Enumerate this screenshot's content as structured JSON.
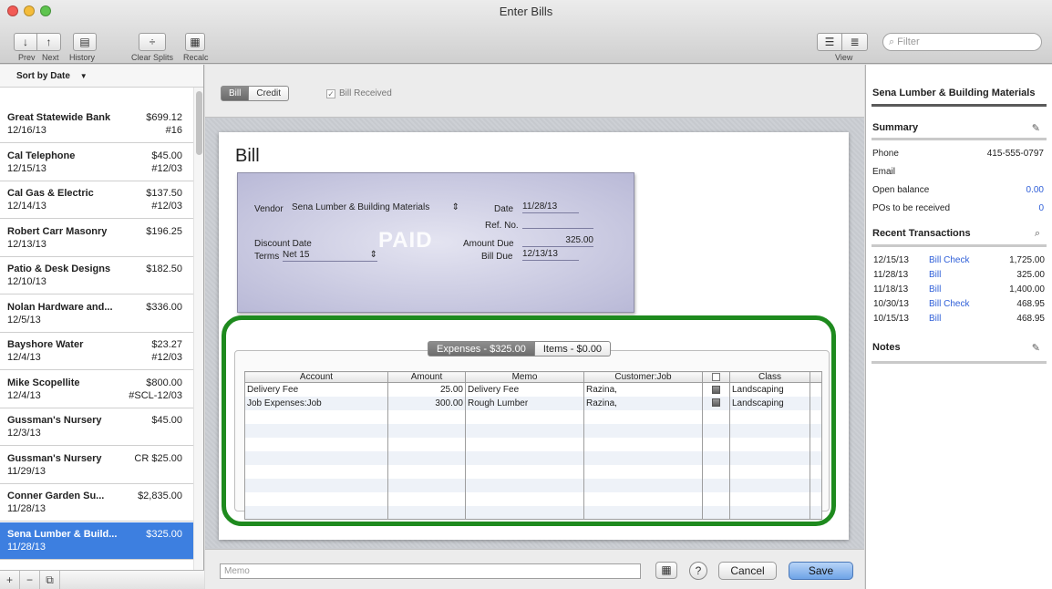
{
  "window": {
    "title": "Enter Bills"
  },
  "toolbar": {
    "prev": "Prev",
    "next": "Next",
    "history": "History",
    "clear_splits": "Clear Splits",
    "recalc": "Recalc",
    "view": "View",
    "filter_placeholder": "Filter"
  },
  "left": {
    "sort_label": "Sort by Date",
    "items": [
      {
        "name": "Great Statewide Bank",
        "date": "12/16/13",
        "amount": "$699.12",
        "ref": "#16"
      },
      {
        "name": "Cal Telephone",
        "date": "12/15/13",
        "amount": "$45.00",
        "ref": "#12/03"
      },
      {
        "name": "Cal Gas & Electric",
        "date": "12/14/13",
        "amount": "$137.50",
        "ref": "#12/03"
      },
      {
        "name": "Robert Carr Masonry",
        "date": "12/13/13",
        "amount": "$196.25",
        "ref": ""
      },
      {
        "name": "Patio & Desk Designs",
        "date": "12/10/13",
        "amount": "$182.50",
        "ref": ""
      },
      {
        "name": "Nolan Hardware and...",
        "date": "12/5/13",
        "amount": "$336.00",
        "ref": ""
      },
      {
        "name": "Bayshore Water",
        "date": "12/4/13",
        "amount": "$23.27",
        "ref": "#12/03"
      },
      {
        "name": "Mike Scopellite",
        "date": "12/4/13",
        "amount": "$800.00",
        "ref": "#SCL-12/03"
      },
      {
        "name": "Gussman's Nursery",
        "date": "12/3/13",
        "amount": "$45.00",
        "ref": ""
      },
      {
        "name": "Gussman's Nursery",
        "date": "11/29/13",
        "amount": "CR $25.00",
        "ref": ""
      },
      {
        "name": "Conner Garden Su...",
        "date": "11/28/13",
        "amount": "$2,835.00",
        "ref": ""
      },
      {
        "name": "Sena Lumber & Build...",
        "date": "11/28/13",
        "amount": "$325.00",
        "ref": ""
      }
    ]
  },
  "center": {
    "seg_bill": "Bill",
    "seg_credit": "Credit",
    "bill_received": "Bill Received",
    "heading": "Bill",
    "form": {
      "vendor_label": "Vendor",
      "vendor": "Sena Lumber & Building Materials",
      "date_label": "Date",
      "date": "11/28/13",
      "refno_label": "Ref. No.",
      "refno": "",
      "discount_label": "Discount Date",
      "amount_due_label": "Amount Due",
      "amount_due": "325.00",
      "terms_label": "Terms",
      "terms": "Net 15",
      "bill_due_label": "Bill Due",
      "bill_due": "12/13/13",
      "stamp": "PAID"
    },
    "tabs": {
      "expenses": "Expenses - $325.00",
      "items": "Items - $0.00"
    },
    "grid": {
      "headers": [
        "Account",
        "Amount",
        "Memo",
        "Customer:Job",
        "",
        "Class"
      ],
      "rows": [
        {
          "account": "Delivery Fee",
          "amount": "25.00",
          "memo": "Delivery Fee",
          "job": "Razina,",
          "cls": "Landscaping"
        },
        {
          "account": "Job Expenses:Job",
          "amount": "300.00",
          "memo": "Rough Lumber",
          "job": "Razina,",
          "cls": "Landscaping"
        }
      ]
    },
    "memo_placeholder": "Memo",
    "cancel": "Cancel",
    "save": "Save"
  },
  "right": {
    "vendor_name": "Sena Lumber & Building Materials",
    "summary_title": "Summary",
    "phone_label": "Phone",
    "phone": "415-555-0797",
    "email_label": "Email",
    "open_balance_label": "Open balance",
    "open_balance": "0.00",
    "pos_label": "POs to be received",
    "pos": "0",
    "recent_title": "Recent Transactions",
    "transactions": [
      {
        "date": "12/15/13",
        "type": "Bill Check",
        "amount": "1,725.00"
      },
      {
        "date": "11/28/13",
        "type": "Bill",
        "amount": "325.00"
      },
      {
        "date": "11/18/13",
        "type": "Bill",
        "amount": "1,400.00"
      },
      {
        "date": "10/30/13",
        "type": "Bill Check",
        "amount": "468.95"
      },
      {
        "date": "10/15/13",
        "type": "Bill",
        "amount": "468.95"
      }
    ],
    "notes_title": "Notes"
  }
}
